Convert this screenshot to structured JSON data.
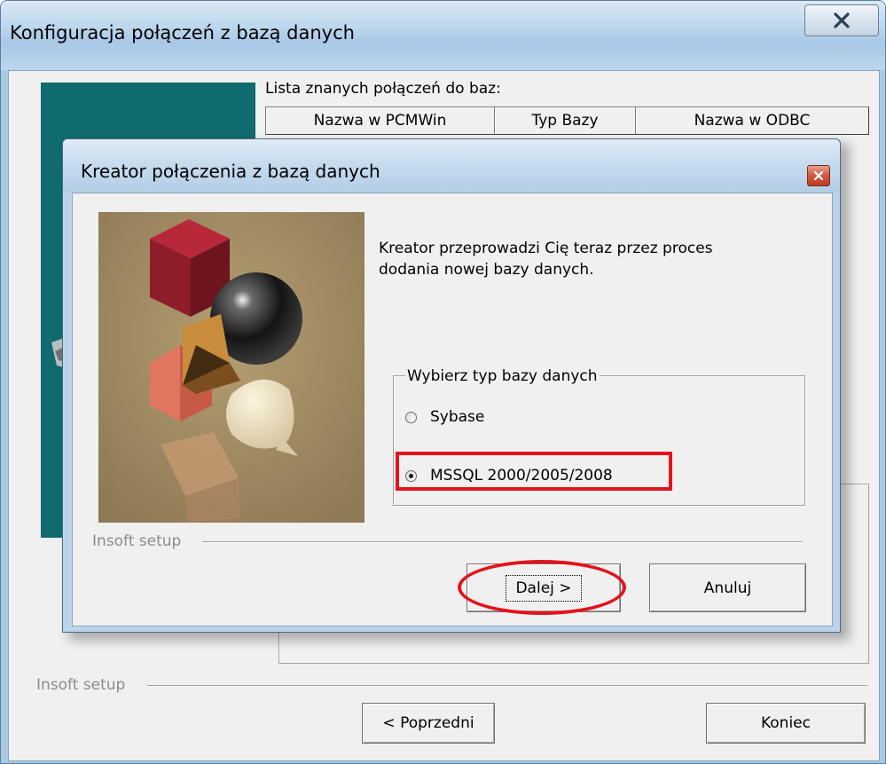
{
  "outer_window": {
    "title": "Konfiguracja połączeń z bazą danych",
    "close_glyph": "X",
    "list_caption": "Lista znanych połączeń do baz:",
    "columns": [
      "Nazwa w PCMWin",
      "Typ Bazy",
      "Nazwa w ODBC"
    ],
    "separator_label": "Insoft setup",
    "buttons": {
      "previous": "< Poprzedni",
      "finish": "Koniec"
    }
  },
  "inner_dialog": {
    "title": "Kreator połączenia z bazą danych",
    "description_lines": [
      "Kreator przeprowadzi Cię teraz przez proces",
      "dodania nowej bazy danych."
    ],
    "group_label": "Wybierz typ bazy danych",
    "options": [
      {
        "label": "Sybase",
        "selected": false
      },
      {
        "label": "MSSQL 2000/2005/2008",
        "selected": true
      }
    ],
    "separator_label": "Insoft setup",
    "buttons": {
      "next": "Dalej >",
      "cancel": "Anuluj"
    }
  },
  "annotations": {
    "highlight_color": "#e4131b",
    "highlighted": [
      "MSSQL 2000/2005/2008",
      "Dalej >"
    ]
  },
  "colors": {
    "title_bar": "#c3dbef",
    "client_background": "#f0f0f0",
    "teal_panel": "#0f6b6e",
    "close_button_red": "#d0583f"
  }
}
